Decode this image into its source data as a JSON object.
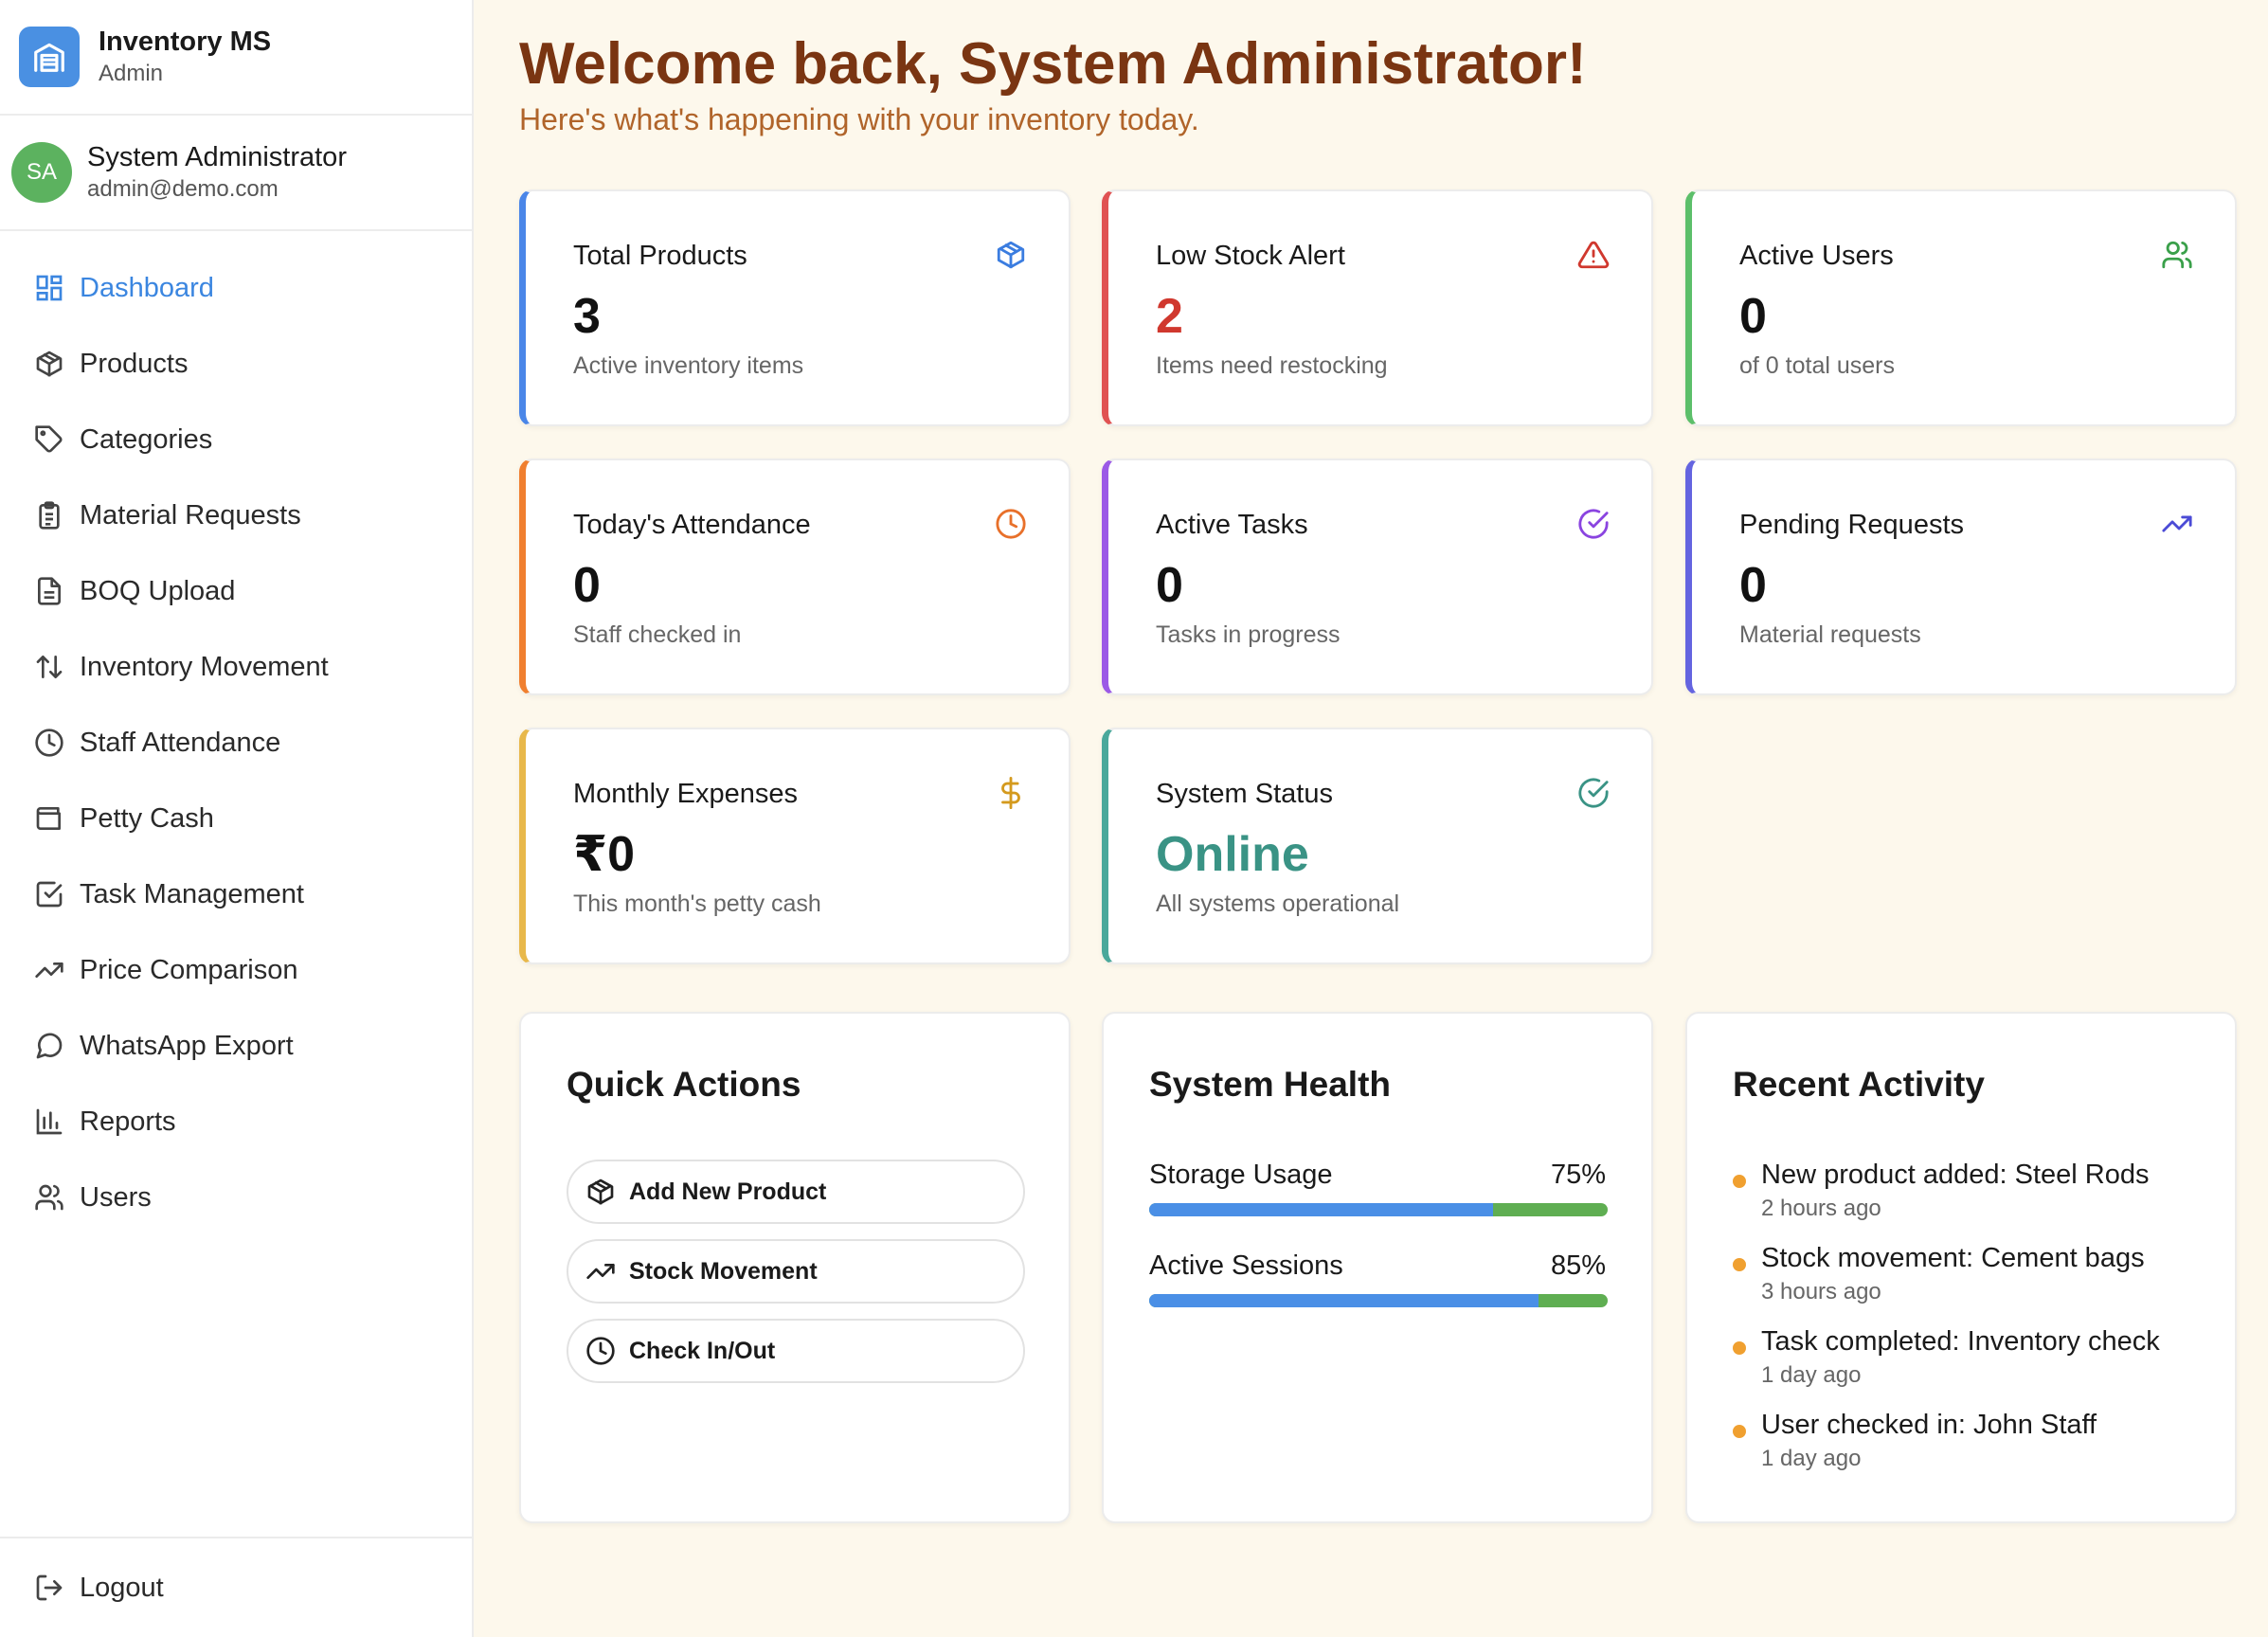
{
  "brand": {
    "title": "Inventory MS",
    "subtitle": "Admin",
    "icon": "warehouse-icon"
  },
  "profile": {
    "initials": "SA",
    "name": "System Administrator",
    "email": "admin@demo.com",
    "avatar_color": "#5cb25f"
  },
  "nav": [
    {
      "label": "Dashboard",
      "icon": "dashboard-icon",
      "active": true
    },
    {
      "label": "Products",
      "icon": "package-icon"
    },
    {
      "label": "Categories",
      "icon": "tag-icon"
    },
    {
      "label": "Material Requests",
      "icon": "clipboard-icon"
    },
    {
      "label": "BOQ Upload",
      "icon": "file-text-icon"
    },
    {
      "label": "Inventory Movement",
      "icon": "arrows-up-down-icon"
    },
    {
      "label": "Staff Attendance",
      "icon": "clock-icon"
    },
    {
      "label": "Petty Cash",
      "icon": "wallet-icon"
    },
    {
      "label": "Task Management",
      "icon": "check-square-icon"
    },
    {
      "label": "Price Comparison",
      "icon": "trending-up-icon"
    },
    {
      "label": "WhatsApp Export",
      "icon": "message-circle-icon"
    },
    {
      "label": "Reports",
      "icon": "bar-chart-icon"
    },
    {
      "label": "Users",
      "icon": "users-icon"
    }
  ],
  "logout": {
    "label": "Logout",
    "icon": "logout-icon"
  },
  "header": {
    "title": "Welcome back, System Administrator!",
    "subtitle": "Here's what's happening with your inventory today."
  },
  "stats": [
    {
      "label": "Total Products",
      "value": "3",
      "note": "Active inventory items",
      "icon": "package-icon",
      "accent": "#4a86e8",
      "value_color": "#111111"
    },
    {
      "label": "Low Stock Alert",
      "value": "2",
      "note": "Items need restocking",
      "icon": "alert-triangle-icon",
      "accent": "#e05252",
      "value_color": "#d0382e"
    },
    {
      "label": "Active Users",
      "value": "0",
      "note": "of 0 total users",
      "icon": "users-icon",
      "accent": "#5cbf6a",
      "value_color": "#111111"
    },
    {
      "label": "Today's Attendance",
      "value": "0",
      "note": "Staff checked in",
      "icon": "clock-icon",
      "accent": "#f07f2f",
      "value_color": "#111111"
    },
    {
      "label": "Active Tasks",
      "value": "0",
      "note": "Tasks in progress",
      "icon": "check-circle-icon",
      "accent": "#9b59e6",
      "value_color": "#111111"
    },
    {
      "label": "Pending Requests",
      "value": "0",
      "note": "Material requests",
      "icon": "trending-up-icon",
      "accent": "#6464e0",
      "value_color": "#111111"
    },
    {
      "label": "Monthly Expenses",
      "value": "₹0",
      "note": "This month's petty cash",
      "icon": "dollar-icon",
      "accent": "#e8b84a",
      "value_color": "#111111"
    },
    {
      "label": "System Status",
      "value": "Online",
      "note": "All systems operational",
      "icon": "check-circle-icon",
      "accent": "#4aa89b",
      "value_color": "#3a9385"
    }
  ],
  "quick_actions": {
    "title": "Quick Actions",
    "buttons": [
      {
        "label": "Add New Product",
        "icon": "package-icon"
      },
      {
        "label": "Stock Movement",
        "icon": "trending-up-icon"
      },
      {
        "label": "Check In/Out",
        "icon": "clock-icon"
      }
    ]
  },
  "system_health": {
    "title": "System Health",
    "metrics": [
      {
        "label": "Storage Usage",
        "value": "75%",
        "fill": 0.75
      },
      {
        "label": "Active Sessions",
        "value": "85%",
        "fill": 0.85
      }
    ]
  },
  "recent_activity": {
    "title": "Recent Activity",
    "items": [
      {
        "text": "New product added: Steel Rods",
        "time": "2 hours ago"
      },
      {
        "text": "Stock movement: Cement bags",
        "time": "3 hours ago"
      },
      {
        "text": "Task completed: Inventory check",
        "time": "1 day ago"
      },
      {
        "text": "User checked in: John Staff",
        "time": "1 day ago"
      }
    ]
  }
}
